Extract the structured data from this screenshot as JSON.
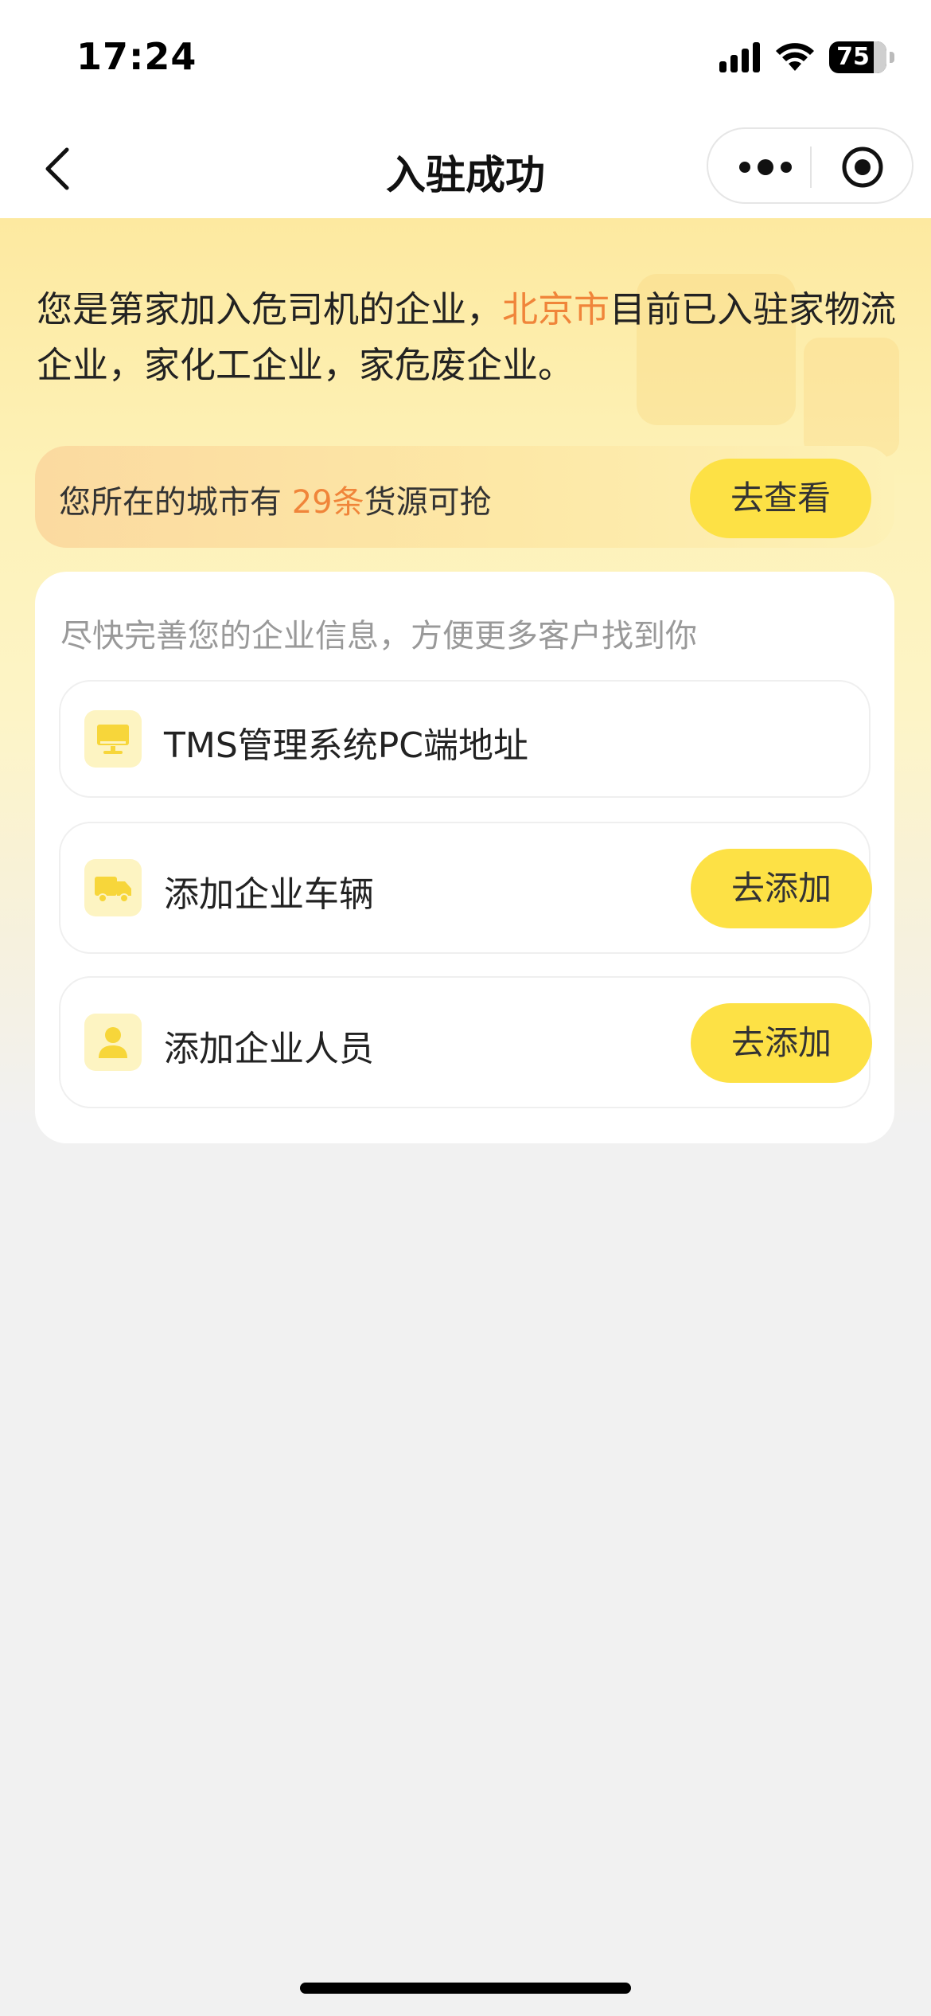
{
  "status_bar": {
    "time": "17:24",
    "battery": "75"
  },
  "nav": {
    "title": "入驻成功"
  },
  "intro": {
    "part1": "您是第家加入危司机的企业，",
    "city": "北京市",
    "part2": "目前已入驻家物流企业，家化工企业，家危废企业。"
  },
  "cargo_banner": {
    "prefix": "您所在的城市有 ",
    "count": "29条",
    "suffix": "货源可抢",
    "button": "去查看"
  },
  "info_card": {
    "hint": "尽快完善您的企业信息，方便更多客户找到你",
    "items": [
      {
        "label": "TMS管理系统PC端地址",
        "icon": "monitor-icon"
      },
      {
        "label": "添加企业车辆",
        "icon": "truck-icon",
        "button": "去添加"
      },
      {
        "label": "添加企业人员",
        "icon": "person-icon",
        "button": "去添加"
      }
    ]
  },
  "colors": {
    "accent_yellow": "#fde145",
    "highlight_orange": "#f0853a",
    "icon_yellow": "#f7d63a"
  }
}
